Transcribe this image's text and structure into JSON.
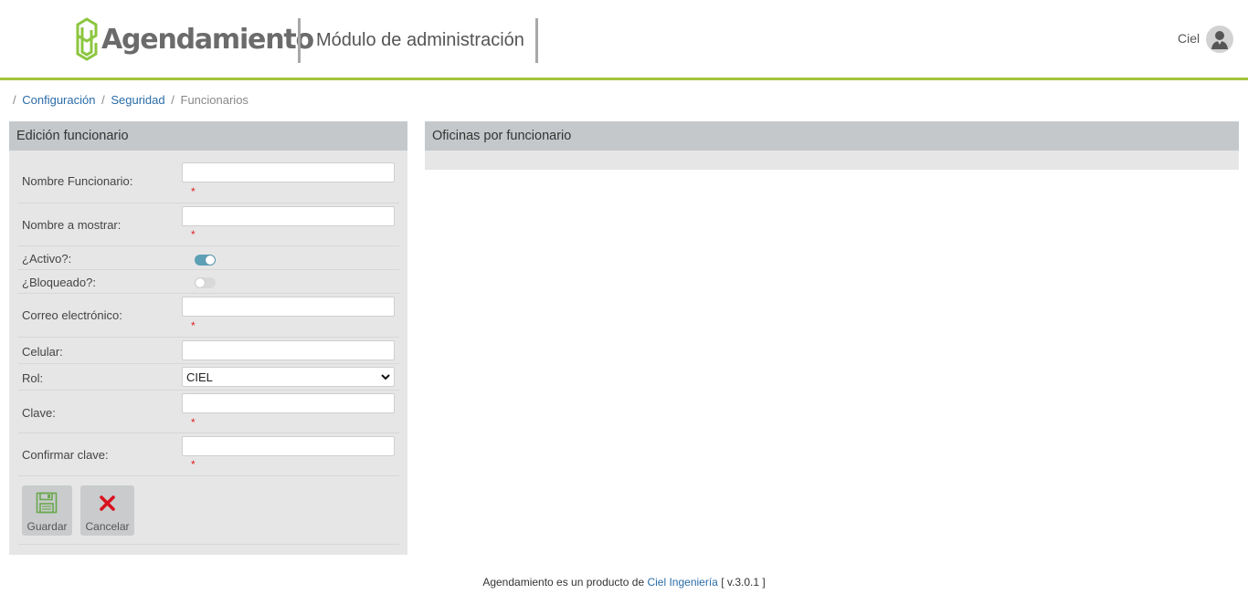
{
  "header": {
    "logo_text": "Agendamiento",
    "module_title": "Módulo de administración",
    "user_name": "Ciel"
  },
  "breadcrumb": {
    "items": [
      "Configuración",
      "Seguridad"
    ],
    "current": "Funcionarios",
    "separator": "/"
  },
  "edit_panel": {
    "title": "Edición funcionario",
    "fields": {
      "nombre_funcionario": {
        "label": "Nombre Funcionario:",
        "value": ""
      },
      "nombre_mostrar": {
        "label": "Nombre a mostrar:",
        "value": ""
      },
      "activo": {
        "label": "¿Activo?:",
        "checked": true
      },
      "bloqueado": {
        "label": "¿Bloqueado?:",
        "checked": false
      },
      "correo": {
        "label": "Correo electrónico:",
        "value": ""
      },
      "celular": {
        "label": "Celular:",
        "value": ""
      },
      "rol": {
        "label": "Rol:",
        "selected": "CIEL"
      },
      "clave": {
        "label": "Clave:",
        "value": ""
      },
      "confirmar_clave": {
        "label": "Confirmar clave:",
        "value": ""
      }
    },
    "required_mark": "*",
    "buttons": {
      "save": {
        "label": "Guardar",
        "icon": "save-icon"
      },
      "cancel": {
        "label": "Cancelar",
        "icon": "close-icon"
      }
    }
  },
  "offices_panel": {
    "title": "Oficinas por funcionario"
  },
  "footer": {
    "text": "Agendamiento es un producto de",
    "link": "Ciel Ingeniería",
    "version": "[ v.3.0.1 ]"
  },
  "colors": {
    "accent_green": "#a3c43b",
    "toggle_on": "#5d9fb5",
    "link_blue": "#2a6ca8",
    "cancel_red": "#d9121f",
    "panel_header": "#c5c8ca",
    "panel_body": "#e6e6e6"
  }
}
